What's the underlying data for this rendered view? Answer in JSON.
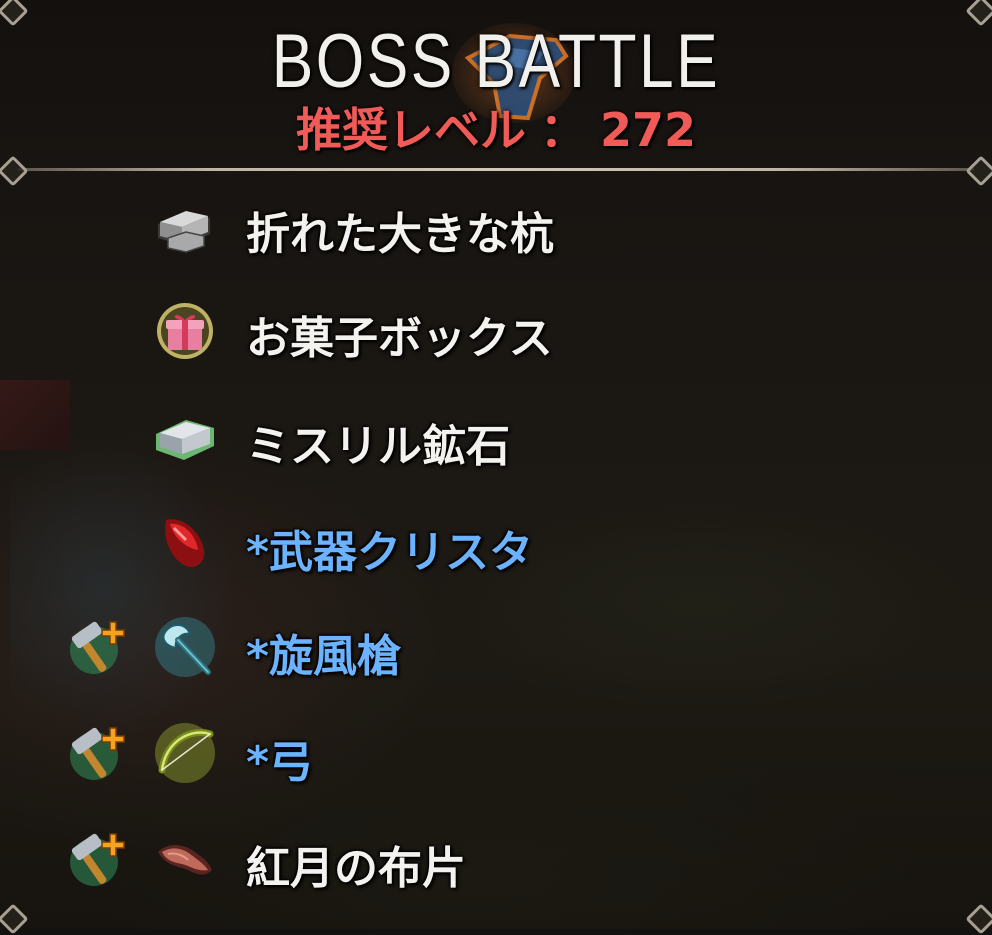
{
  "header": {
    "title": "BOSS BATTLE",
    "recommended_level_label": "推奨レベル",
    "separator": "：",
    "recommended_level_value": "272"
  },
  "drops": [
    {
      "name": "折れた大きな杭",
      "icon": "iron-ingot-icon",
      "highlight": false,
      "craftable": false
    },
    {
      "name": "お菓子ボックス",
      "icon": "gift-box-icon",
      "highlight": false,
      "craftable": false
    },
    {
      "name": "ミスリル鉱石",
      "icon": "mithril-ingot-icon",
      "highlight": false,
      "craftable": false
    },
    {
      "name": "*武器クリスタ",
      "icon": "red-crystal-icon",
      "highlight": true,
      "craftable": false
    },
    {
      "name": "*旋風槍",
      "icon": "halberd-icon",
      "highlight": true,
      "craftable": true
    },
    {
      "name": "*弓",
      "icon": "bow-icon",
      "highlight": true,
      "craftable": true
    },
    {
      "name": "紅月の布片",
      "icon": "cloth-scrap-icon",
      "highlight": false,
      "craftable": true
    }
  ],
  "colors": {
    "title": "#f2f0ec",
    "recommended_level": "#f05a57",
    "item_normal": "#f4f2ee",
    "item_highlight": "#6cb3ff"
  }
}
